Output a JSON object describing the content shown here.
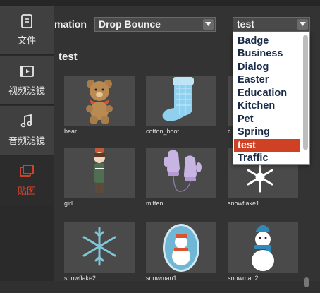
{
  "sidebar": {
    "items": [
      {
        "label": "文件",
        "icon": "document-icon",
        "active": false
      },
      {
        "label": "视频滤镜",
        "icon": "video-filter-icon",
        "active": false
      },
      {
        "label": "音频滤镜",
        "icon": "music-note-icon",
        "active": false
      },
      {
        "label": "贴图",
        "icon": "sticker-icon",
        "active": true
      }
    ]
  },
  "toolbar": {
    "animation_label": "mation",
    "animation_value": "Drop Bounce",
    "category_value": "test"
  },
  "section_title": "test",
  "stickers": [
    {
      "name": "bear",
      "icon": "bear-icon"
    },
    {
      "name": "cotton_boot",
      "icon": "boot-icon"
    },
    {
      "name": "c",
      "icon": "sticker-icon"
    },
    {
      "name": "girl",
      "icon": "girl-icon"
    },
    {
      "name": "mitten",
      "icon": "mitten-icon"
    },
    {
      "name": "snowflake1",
      "icon": "snowflake-icon"
    },
    {
      "name": "snowflake2",
      "icon": "snowflake-icon"
    },
    {
      "name": "snowman1",
      "icon": "snowman-icon"
    },
    {
      "name": "snowman2",
      "icon": "snowman-icon"
    }
  ],
  "dropdown": {
    "options": [
      "Badge",
      "Business",
      "Dialog",
      "Easter",
      "Education",
      "Kitchen",
      "Pet",
      "Spring",
      "test",
      "Traffic"
    ],
    "selected": "test"
  },
  "colors": {
    "accent": "#cf4125",
    "sidebar_bg": "#404040",
    "panel_bg": "#333333",
    "thumb_bg": "#4a4a4a"
  }
}
